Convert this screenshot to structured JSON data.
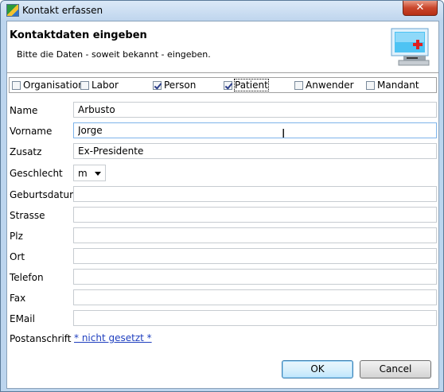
{
  "window": {
    "title": "Kontakt erfassen",
    "close_label": "✕"
  },
  "header": {
    "title": "Kontaktdaten eingeben",
    "subtitle": "Bitte die Daten - soweit bekannt - eingeben."
  },
  "types": [
    {
      "label": "Organisation",
      "checked": false
    },
    {
      "label": "Labor",
      "checked": false
    },
    {
      "label": "Person",
      "checked": true
    },
    {
      "label": "Patient",
      "checked": true
    },
    {
      "label": "Anwender",
      "checked": false
    },
    {
      "label": "Mandant",
      "checked": false
    }
  ],
  "fields": {
    "name": {
      "label": "Name",
      "value": "Arbusto"
    },
    "vorname": {
      "label": "Vorname",
      "value": "Jorge"
    },
    "zusatz": {
      "label": "Zusatz",
      "value": "Ex-Presidente"
    },
    "geschlecht": {
      "label": "Geschlecht",
      "value": "m"
    },
    "geburtsdatum": {
      "label": "Geburtsdatum",
      "value": ""
    },
    "strasse": {
      "label": "Strasse",
      "value": ""
    },
    "plz": {
      "label": "Plz",
      "value": ""
    },
    "ort": {
      "label": "Ort",
      "value": ""
    },
    "telefon": {
      "label": "Telefon",
      "value": ""
    },
    "fax": {
      "label": "Fax",
      "value": ""
    },
    "email": {
      "label": "EMail",
      "value": ""
    },
    "postanschrift": {
      "label": "Postanschrift",
      "value": "* nicht gesetzt *"
    }
  },
  "buttons": {
    "ok": "OK",
    "cancel": "Cancel"
  },
  "icons": {
    "app": "app-icon",
    "header": "monitor-add-icon",
    "cursor": "text-cursor-icon"
  }
}
